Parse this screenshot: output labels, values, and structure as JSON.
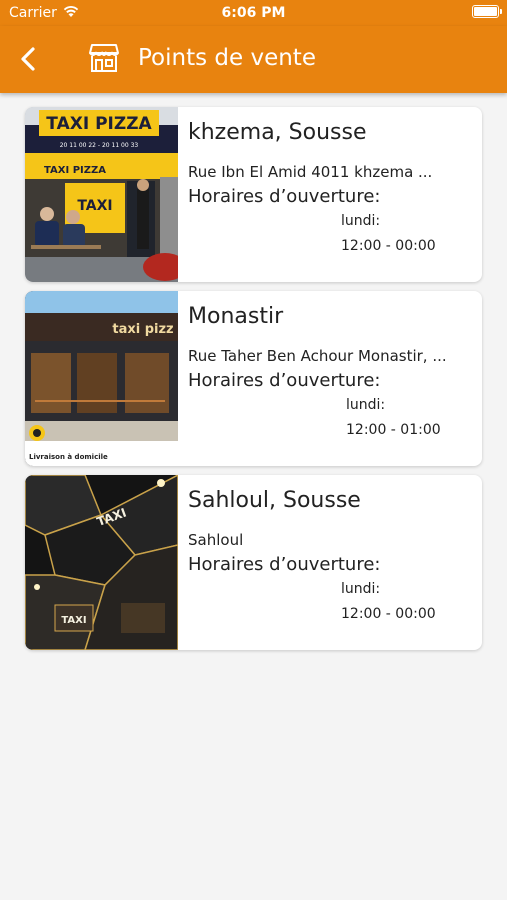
{
  "status": {
    "carrier": "Carrier",
    "time": "6:06 PM"
  },
  "nav": {
    "title": "Points de vente"
  },
  "stores": [
    {
      "name": "khzema, Sousse",
      "address": "Rue Ibn El Amid 4011 khzema ...",
      "hours_label": "Horaires d’ouverture:",
      "day": "lundi:",
      "hours": "12:00 - 00:00",
      "photo_sign": "TAXI PIZZA",
      "photo_sub": "20 11 00 22 - 20 11 00 33",
      "photo_awning": "TAXI PIZZA"
    },
    {
      "name": "Monastir",
      "address": "Rue Taher Ben Achour Monastir, ...",
      "hours_label": "Horaires d’ouverture:",
      "day": "lundi:",
      "hours": "12:00 - 01:00",
      "photo_sign": "taxi pizz",
      "photo_caption": "Livraison à domicile"
    },
    {
      "name": "Sahloul, Sousse",
      "address": "Sahloul",
      "hours_label": "Horaires d’ouverture:",
      "day": "lundi:",
      "hours": "12:00 - 00:00",
      "photo_sign": "TAXI",
      "photo_sign2": "TAXI"
    }
  ],
  "colors": {
    "brand": "#e8830f"
  }
}
